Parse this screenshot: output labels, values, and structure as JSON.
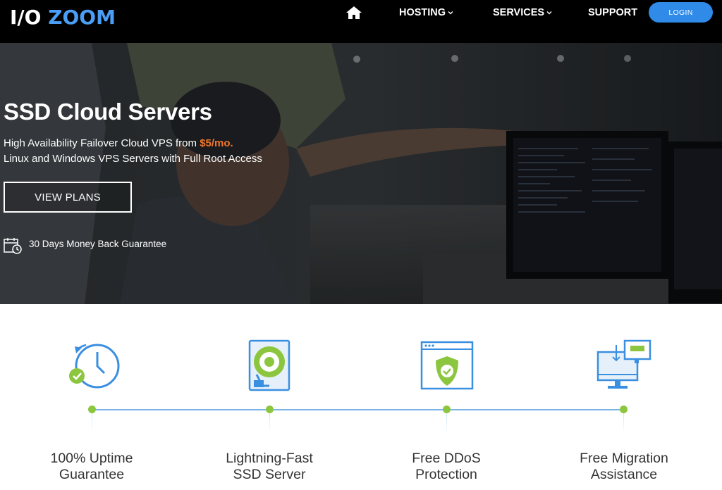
{
  "brand": {
    "logo_part1": "I/O ",
    "logo_part2": "ZOOM"
  },
  "nav": {
    "home_icon": "home-icon",
    "items": [
      {
        "label": "HOSTING",
        "has_dropdown": true
      },
      {
        "label": "SERVICES",
        "has_dropdown": true
      },
      {
        "label": "SUPPORT",
        "has_dropdown": false
      }
    ],
    "login_label": "LOGIN"
  },
  "hero": {
    "title": "SSD Cloud Servers",
    "subtitle_prefix": "High Availability Failover Cloud VPS from ",
    "subtitle_price": "$5/mo.",
    "subtitle_line2": "Linux and Windows VPS Servers with Full Root Access",
    "cta_label": "VIEW PLANS",
    "guarantee_icon": "calendar-clock-icon",
    "guarantee_text": "30 Days Money Back Guarantee"
  },
  "features": [
    {
      "icon": "uptime-clock-icon",
      "line1": "100% Uptime",
      "line2": "Guarantee"
    },
    {
      "icon": "ssd-drive-icon",
      "line1": "Lightning-Fast",
      "line2": "SSD Server"
    },
    {
      "icon": "ddos-shield-icon",
      "line1": "Free DDoS",
      "line2": "Protection"
    },
    {
      "icon": "migration-monitor-icon",
      "line1": "Free Migration",
      "line2": "Assistance"
    }
  ],
  "colors": {
    "navbar_bg": "#000000",
    "brand_accent": "#4a9ef5",
    "login_bg": "#2f8ae8",
    "price_orange": "#f0772c",
    "timeline_dot": "#8cc63f",
    "timeline_line": "#7ab4e8",
    "icon_blue": "#3a8fe0"
  }
}
